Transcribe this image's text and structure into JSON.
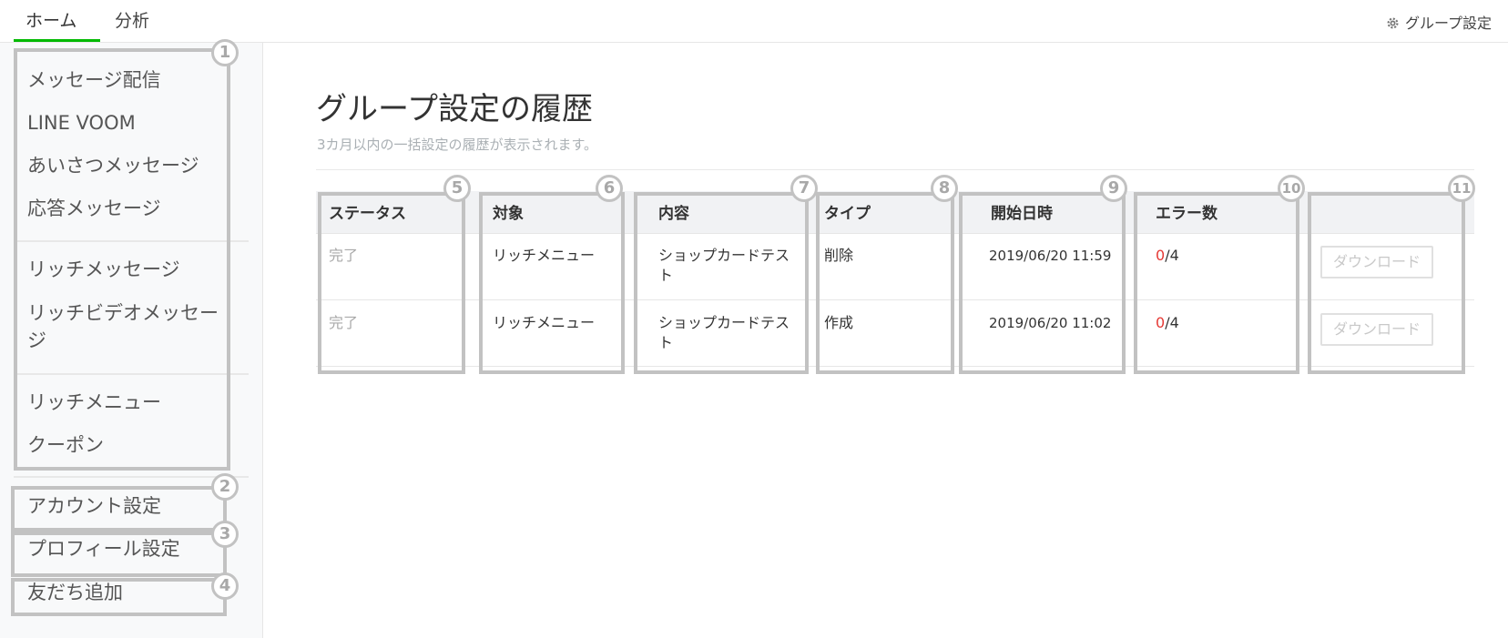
{
  "header": {
    "tabs": [
      {
        "label": "ホーム",
        "active": true
      },
      {
        "label": "分析",
        "active": false
      }
    ],
    "group_settings_label": "グループ設定",
    "group_settings_icon": "gear-icon",
    "accent_color": "#00b900"
  },
  "sidebar": {
    "groups": [
      {
        "items": [
          {
            "label": "メッセージ配信"
          },
          {
            "label": "LINE VOOM"
          },
          {
            "label": "あいさつメッセージ"
          },
          {
            "label": "応答メッセージ"
          }
        ]
      },
      {
        "items": [
          {
            "label": "リッチメッセージ"
          },
          {
            "label": "リッチビデオメッセー"
          },
          {
            "label": "ジ"
          }
        ]
      },
      {
        "items": [
          {
            "label": "リッチメニュー"
          },
          {
            "label": "クーポン"
          }
        ]
      },
      {
        "items": [
          {
            "label": "アカウント設定"
          },
          {
            "label": "プロフィール設定"
          },
          {
            "label": "友だち追加"
          }
        ]
      }
    ]
  },
  "main": {
    "title": "グループ設定の履歴",
    "subtitle": "3カ月以内の一括設定の履歴が表示されます。",
    "table": {
      "columns": [
        "ステータス",
        "対象",
        "内容",
        "タイプ",
        "開始日時",
        "エラー数",
        ""
      ],
      "rows": [
        {
          "status": "完了",
          "target": "リッチメニュー",
          "content_line1": "ショップカードテス",
          "content_line2": "ト",
          "type": "削除",
          "start": "2019/06/20 11:59",
          "error_count": "0",
          "error_total": "/4",
          "download_label": "ダウンロード"
        },
        {
          "status": "完了",
          "target": "リッチメニュー",
          "content_line1": "ショップカードテス",
          "content_line2": "ト",
          "type": "作成",
          "start": "2019/06/20 11:02",
          "error_count": "0",
          "error_total": "/4",
          "download_label": "ダウンロード"
        }
      ]
    }
  },
  "annotations": {
    "markers": [
      "1",
      "2",
      "3",
      "4",
      "5",
      "6",
      "7",
      "8",
      "9",
      "10",
      "11"
    ],
    "color": "#c2c2c2"
  }
}
